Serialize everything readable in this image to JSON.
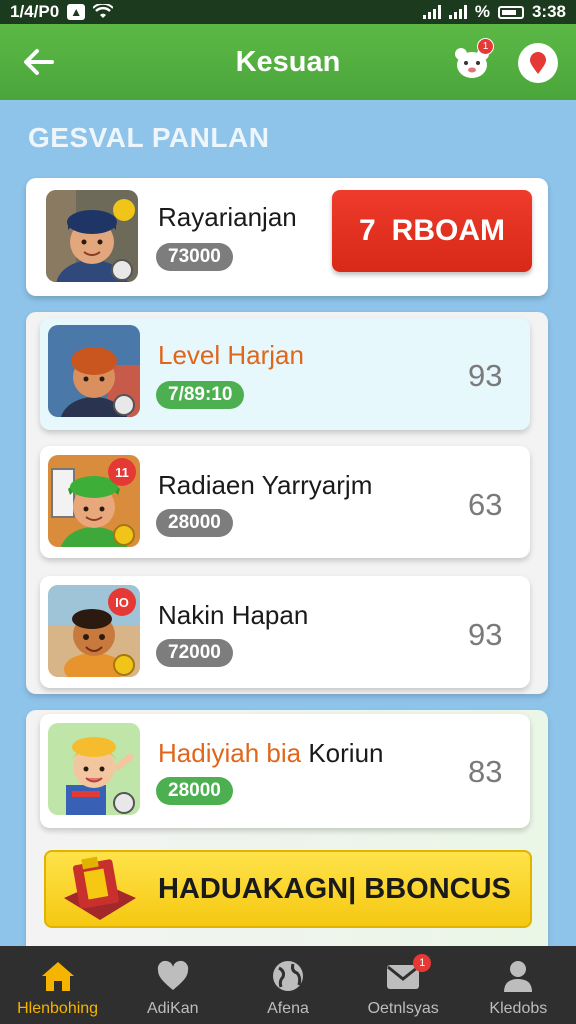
{
  "status_bar": {
    "left_text": "1/4/P0",
    "battery_text": "%",
    "time": "3:38"
  },
  "header": {
    "title": "Kesuan",
    "notification_count": "1"
  },
  "section": {
    "title": "GESVAL PANLAN"
  },
  "top_card": {
    "name": "Rayarianjan",
    "points": "73000",
    "action_number": "7",
    "action_label": "RBOAM"
  },
  "rows": [
    {
      "name": "Level Harjan",
      "points": "7/89:10",
      "score": "93",
      "badge": ""
    },
    {
      "name": "Radiaen Yarryarjm",
      "points": "28000",
      "score": "63",
      "badge": "11"
    },
    {
      "name": "Nakin Hapan",
      "points": "72000",
      "score": "93",
      "badge": "IO"
    },
    {
      "name_part1": "Hadiyiah bia",
      "name_part2": "Koriun",
      "points": "28000",
      "score": "83",
      "badge": ""
    }
  ],
  "bonus_button": {
    "label": "HADUAKAGN| BBONCUS"
  },
  "bottom_nav": {
    "items": [
      {
        "label": "Hlenbohing",
        "icon": "home-icon"
      },
      {
        "label": "AdiKan",
        "icon": "heart-icon"
      },
      {
        "label": "Afena",
        "icon": "globe-icon"
      },
      {
        "label": "Oetnlsyas",
        "icon": "mail-icon",
        "badge": "1"
      },
      {
        "label": "Kledobs",
        "icon": "profile-icon"
      }
    ]
  },
  "colors": {
    "header_green": "#4aa63a",
    "background_blue": "#8ec4ea",
    "action_red": "#e3301f",
    "bonus_yellow": "#f8d324",
    "active_nav": "#f4b400"
  }
}
